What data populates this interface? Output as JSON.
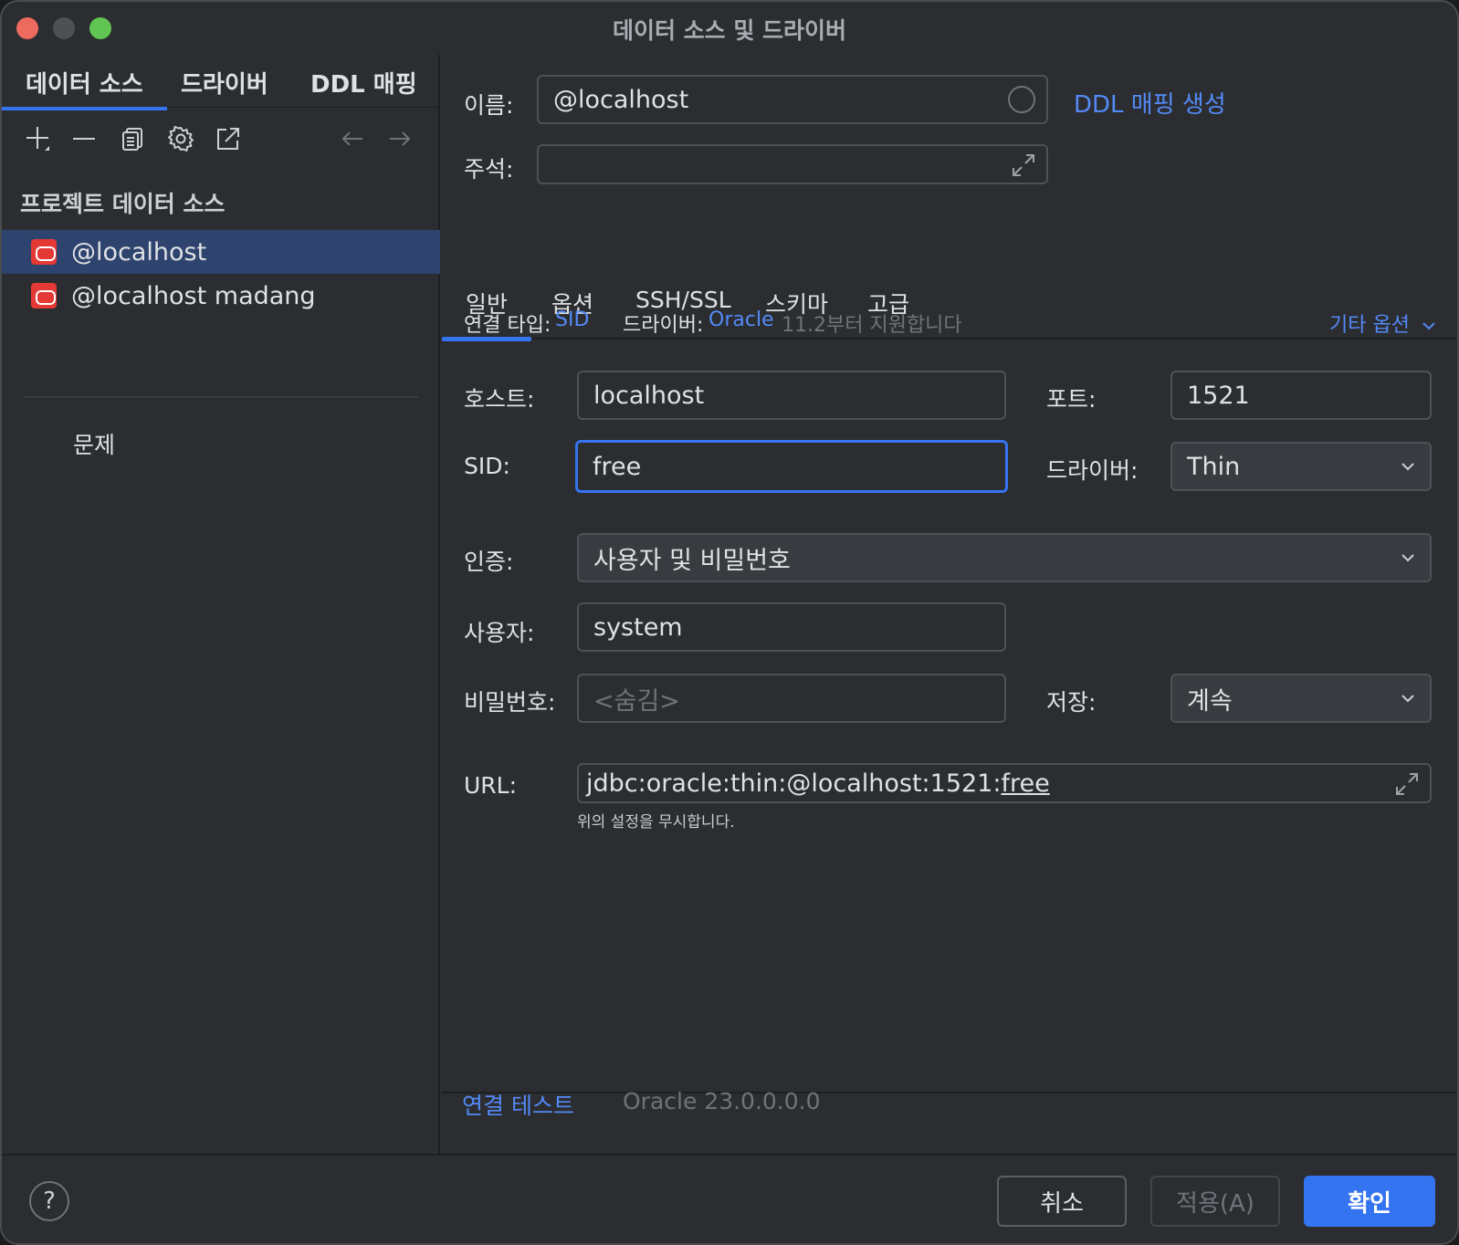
{
  "window": {
    "title": "데이터 소스 및 드라이버"
  },
  "left": {
    "tabs": [
      "데이터 소스",
      "드라이버",
      "DDL 매핑"
    ],
    "section_title": "프로젝트 데이터 소스",
    "datasources": [
      {
        "label": "@localhost",
        "selected": true
      },
      {
        "label": "@localhost madang",
        "selected": false
      }
    ],
    "problems_label": "문제"
  },
  "header": {
    "name_label": "이름:",
    "name_value": "@localhost",
    "ddl_link": "DDL 매핑 생성",
    "comment_label": "주석:",
    "comment_value": ""
  },
  "tabs": [
    "일반",
    "옵션",
    "SSH/SSL",
    "스키마",
    "고급"
  ],
  "connection": {
    "type_label": "연결 타입:",
    "type_value": "SID",
    "driver_label": "드라이버:",
    "driver_value": "Oracle",
    "driver_note": "11.2부터 지원합니다",
    "more_options": "기타 옵션"
  },
  "form": {
    "host_label": "호스트:",
    "host_value": "localhost",
    "port_label": "포트:",
    "port_value": "1521",
    "sid_label": "SID:",
    "sid_value": "free",
    "driver_label": "드라이버:",
    "driver_value": "Thin",
    "auth_label": "인증:",
    "auth_value": "사용자 및 비밀번호",
    "user_label": "사용자:",
    "user_value": "system",
    "password_label": "비밀번호:",
    "password_placeholder": "<숨김>",
    "save_label": "저장:",
    "save_value": "계속",
    "url_label": "URL:",
    "url_prefix": "jdbc:oracle:thin:@localhost:1521:",
    "url_suffix": "free",
    "url_note": "위의 설정을 무시합니다."
  },
  "test": {
    "link": "연결 테스트",
    "version": "Oracle 23.0.0.0.0"
  },
  "footer": {
    "help": "?",
    "cancel": "취소",
    "apply": "적용(A)",
    "ok": "확인"
  },
  "colors": {
    "accent": "#3574f0",
    "link": "#548af7",
    "oracle_red": "#e53935"
  }
}
